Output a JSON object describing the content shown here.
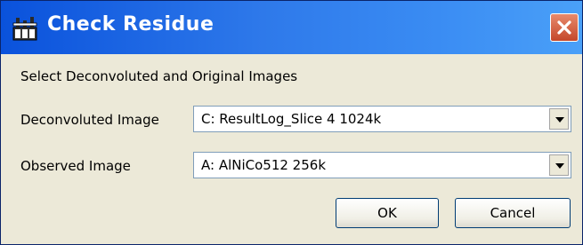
{
  "window": {
    "title": "Check Residue",
    "title_icon": "app-icon",
    "close_icon": "close-icon",
    "colors": {
      "titlebar": "#2e79ea",
      "close_button": "#d4573a",
      "background": "#ece9d8"
    }
  },
  "dialog": {
    "instruction": "Select Deconvoluted and Original Images",
    "deconvoluted": {
      "label": "Deconvoluted Image",
      "value": "C: ResultLog_Slice 4  1024k"
    },
    "observed": {
      "label": "Observed Image",
      "value": "A: AlNiCo512  256k"
    },
    "dropdown_icon": "chevron-down-icon",
    "ok_label": "OK",
    "cancel_label": "Cancel"
  }
}
